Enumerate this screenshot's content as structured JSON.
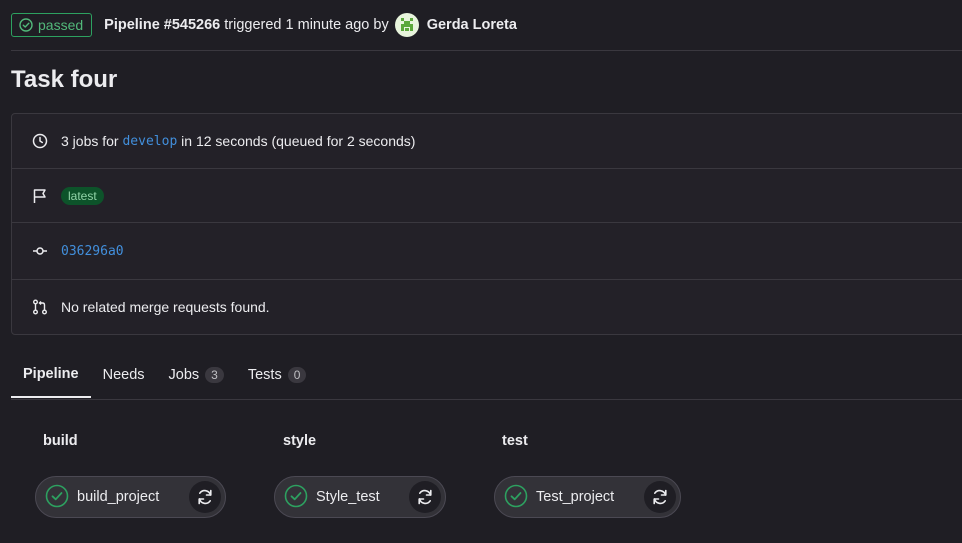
{
  "header": {
    "status": "passed",
    "pipeline": "Pipeline #545266",
    "triggered_text": "triggered 1 minute ago by",
    "author": "Gerda Loreta"
  },
  "title": "Task four",
  "info": {
    "jobs_prefix": "3 jobs for",
    "branch": "develop",
    "jobs_suffix": "in 12 seconds (queued for 2 seconds)",
    "label": "latest",
    "commit": "036296a0",
    "merge_requests": "No related merge requests found."
  },
  "tabs": [
    {
      "label": "Pipeline"
    },
    {
      "label": "Needs"
    },
    {
      "label": "Jobs",
      "count": "3"
    },
    {
      "label": "Tests",
      "count": "0"
    }
  ],
  "stages": [
    {
      "title": "build",
      "job": "build_project"
    },
    {
      "title": "style",
      "job": "Style_test"
    },
    {
      "title": "test",
      "job": "Test_project"
    }
  ],
  "colors": {
    "success": "#2da160",
    "link": "#428fdc",
    "background": "#1f1e24"
  }
}
